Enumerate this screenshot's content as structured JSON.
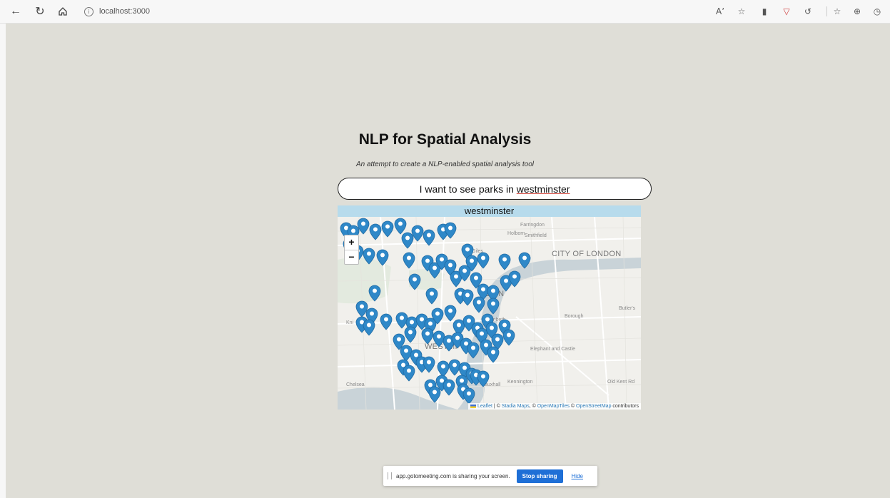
{
  "browser": {
    "url": "localhost:3000",
    "icons": {
      "back": "back-arrow-icon",
      "refresh": "refresh-icon",
      "home": "home-icon",
      "site_info": "info-icon",
      "read_aloud": "read-aloud-icon",
      "favorite": "add-favorite-icon",
      "extension1": "extension-icon",
      "extension2": "shield-extension-icon",
      "extension3": "refresh-extension-icon",
      "favorites_list": "favorites-icon",
      "collections": "collections-icon",
      "history": "history-icon"
    },
    "read_aloud_label": "Aʼ",
    "info_glyph": "i"
  },
  "app": {
    "title": "NLP for Spatial Analysis",
    "subtitle": "An attempt to create a NLP-enabled spatial analysis tool",
    "query_prefix": "I want to see parks in ",
    "query_typo_word": "westminster"
  },
  "map": {
    "header": "westminster",
    "zoom_in": "+",
    "zoom_out": "−",
    "labels": {
      "holborn": "Holborn",
      "city": "CITY OF LONDON",
      "farringdon": "Farringdon",
      "smithfield": "Smithfield",
      "borough": "Borough",
      "lambeth": "Lambeth",
      "westminster": "WESTMI",
      "elephant": "Elephant and Castle",
      "kennington": "Kennington",
      "vauxhall": "Vauxhall",
      "chelsea": "Chelsea",
      "oldkent": "Old Kent Rd",
      "knights": "Kni",
      "giles": "Giles",
      "don": "DON",
      "butler": "Butler's"
    },
    "attribution": {
      "leaflet": "Leaflet",
      "sep1": " | © ",
      "stadia": "Stadia Maps",
      "sep2": ", © ",
      "omt": "OpenMapTiles",
      "sep3": " © ",
      "osm": "OpenStreetMap",
      "tail": " contributors"
    },
    "marker_color": "#2f88c8"
  },
  "share_bar": {
    "message": "app.gotomeeting.com is sharing your screen.",
    "stop_label": "Stop sharing",
    "hide_label": "Hide"
  }
}
